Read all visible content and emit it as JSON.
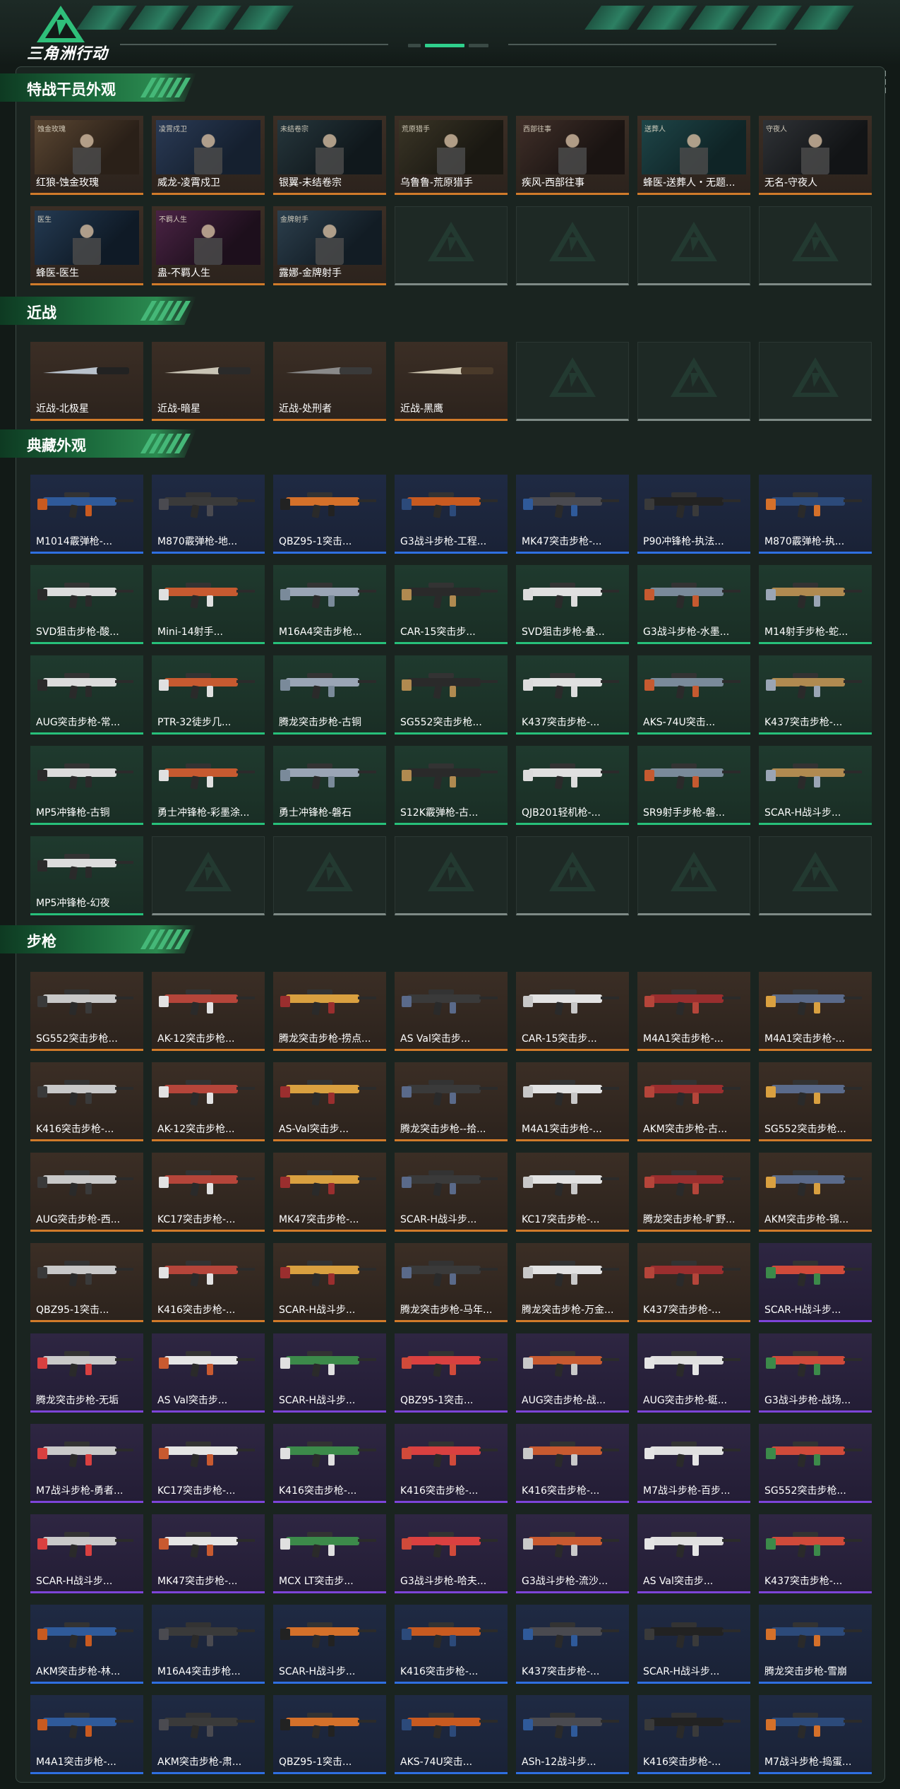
{
  "app": {
    "title": "三角洲行动"
  },
  "colors": {
    "rarity_orange": "#d07a2a",
    "rarity_blue": "#2f6fe0",
    "rarity_green": "#27c07a",
    "rarity_purple": "#7d44d8",
    "accent_green": "#2fd08c"
  },
  "sections": [
    {
      "title": "特战干员外观",
      "items": [
        {
          "name": "红狼-蚀金玫瑰",
          "rarity": "orange",
          "thumb_tag": "蚀金玫瑰"
        },
        {
          "name": "威龙-凌霄戍卫",
          "rarity": "orange",
          "thumb_tag": "凌霄戍卫"
        },
        {
          "name": "银翼-未结卷宗",
          "rarity": "orange",
          "thumb_tag": "未结卷宗"
        },
        {
          "name": "乌鲁鲁-荒原猎手",
          "rarity": "orange",
          "thumb_tag": "荒原猎手"
        },
        {
          "name": "疾风-西部往事",
          "rarity": "orange",
          "thumb_tag": "西部往事"
        },
        {
          "name": "蜂医-送葬人・无题...",
          "rarity": "orange",
          "thumb_tag": "送葬人"
        },
        {
          "name": "无名-守夜人",
          "rarity": "orange",
          "thumb_tag": "守夜人"
        },
        {
          "name": "蜂医-医生",
          "rarity": "orange",
          "thumb_tag": "医生"
        },
        {
          "name": "蛊-不羁人生",
          "rarity": "orange",
          "thumb_tag": "不羁人生"
        },
        {
          "name": "露娜-金牌射手",
          "rarity": "orange",
          "thumb_tag": "金牌射手"
        }
      ],
      "empty_slots": 4
    },
    {
      "title": "近战",
      "items": [
        {
          "name": "近战-北极星",
          "rarity": "orange"
        },
        {
          "name": "近战-暗星",
          "rarity": "orange"
        },
        {
          "name": "近战-处刑者",
          "rarity": "orange"
        },
        {
          "name": "近战-黑鹰",
          "rarity": "orange"
        }
      ],
      "empty_slots": 3
    },
    {
      "title": "典藏外观",
      "items": [
        {
          "name": "M1014霰弹枪-...",
          "rarity": "blue"
        },
        {
          "name": "M870霰弹枪-地...",
          "rarity": "blue"
        },
        {
          "name": "QBZ95-1突击...",
          "rarity": "blue"
        },
        {
          "name": "G3战斗步枪-工程...",
          "rarity": "blue"
        },
        {
          "name": "MK47突击步枪-...",
          "rarity": "blue"
        },
        {
          "name": "P90冲锋枪-执法...",
          "rarity": "blue"
        },
        {
          "name": "M870霰弹枪-执...",
          "rarity": "blue"
        },
        {
          "name": "SVD狙击步枪-酸...",
          "rarity": "green"
        },
        {
          "name": "Mini-14射手...",
          "rarity": "green"
        },
        {
          "name": "M16A4突击步枪...",
          "rarity": "green"
        },
        {
          "name": "CAR-15突击步...",
          "rarity": "green"
        },
        {
          "name": "SVD狙击步枪-叠...",
          "rarity": "green"
        },
        {
          "name": "G3战斗步枪-水墨...",
          "rarity": "green"
        },
        {
          "name": "M14射手步枪-蛇...",
          "rarity": "green"
        },
        {
          "name": "AUG突击步枪-常...",
          "rarity": "green"
        },
        {
          "name": "PTR-32徒步几...",
          "rarity": "green"
        },
        {
          "name": "腾龙突击步枪-古铜",
          "rarity": "green"
        },
        {
          "name": "SG552突击步枪...",
          "rarity": "green"
        },
        {
          "name": "K437突击步枪-...",
          "rarity": "green"
        },
        {
          "name": "AKS-74U突击...",
          "rarity": "green"
        },
        {
          "name": "K437突击步枪-...",
          "rarity": "green"
        },
        {
          "name": "MP5冲锋枪-古铜",
          "rarity": "green"
        },
        {
          "name": "勇士冲锋枪-彩墨涂...",
          "rarity": "green"
        },
        {
          "name": "勇士冲锋枪-磐石",
          "rarity": "green"
        },
        {
          "name": "S12K霰弹枪-古...",
          "rarity": "green"
        },
        {
          "name": "QJB201轻机枪-...",
          "rarity": "green"
        },
        {
          "name": "SR9射手步枪-磐...",
          "rarity": "green"
        },
        {
          "name": "SCAR-H战斗步...",
          "rarity": "green"
        },
        {
          "name": "MP5冲锋枪-幻夜",
          "rarity": "green"
        }
      ],
      "empty_slots": 6
    },
    {
      "title": "步枪",
      "items": [
        {
          "name": "SG552突击步枪...",
          "rarity": "orange"
        },
        {
          "name": "AK-12突击步枪...",
          "rarity": "orange"
        },
        {
          "name": "腾龙突击步枪-捞点...",
          "rarity": "orange"
        },
        {
          "name": "AS Val突击步...",
          "rarity": "orange"
        },
        {
          "name": "CAR-15突击步...",
          "rarity": "orange"
        },
        {
          "name": "M4A1突击步枪-...",
          "rarity": "orange"
        },
        {
          "name": "M4A1突击步枪-...",
          "rarity": "orange"
        },
        {
          "name": "K416突击步枪-...",
          "rarity": "orange"
        },
        {
          "name": "AK-12突击步枪...",
          "rarity": "orange"
        },
        {
          "name": "AS-Val突击步...",
          "rarity": "orange"
        },
        {
          "name": "腾龙突击步枪--拾...",
          "rarity": "orange"
        },
        {
          "name": "M4A1突击步枪-...",
          "rarity": "orange"
        },
        {
          "name": "AKM突击步枪-古...",
          "rarity": "orange"
        },
        {
          "name": "SG552突击步枪...",
          "rarity": "orange"
        },
        {
          "name": "AUG突击步枪-西...",
          "rarity": "orange"
        },
        {
          "name": "KC17突击步枪-...",
          "rarity": "orange"
        },
        {
          "name": "MK47突击步枪-...",
          "rarity": "orange"
        },
        {
          "name": "SCAR-H战斗步...",
          "rarity": "orange"
        },
        {
          "name": "KC17突击步枪-...",
          "rarity": "orange"
        },
        {
          "name": "腾龙突击步枪-旷野...",
          "rarity": "orange"
        },
        {
          "name": "AKM突击步枪-锦...",
          "rarity": "orange"
        },
        {
          "name": "QBZ95-1突击...",
          "rarity": "orange"
        },
        {
          "name": "K416突击步枪-...",
          "rarity": "orange"
        },
        {
          "name": "SCAR-H战斗步...",
          "rarity": "orange"
        },
        {
          "name": "腾龙突击步枪-马年...",
          "rarity": "orange"
        },
        {
          "name": "腾龙突击步枪-万金...",
          "rarity": "orange"
        },
        {
          "name": "K437突击步枪-...",
          "rarity": "orange"
        },
        {
          "name": "SCAR-H战斗步...",
          "rarity": "purple"
        },
        {
          "name": "腾龙突击步枪-无垢",
          "rarity": "purple"
        },
        {
          "name": "AS Val突击步...",
          "rarity": "purple"
        },
        {
          "name": "SCAR-H战斗步...",
          "rarity": "purple"
        },
        {
          "name": "QBZ95-1突击...",
          "rarity": "purple"
        },
        {
          "name": "AUG突击步枪-战...",
          "rarity": "purple"
        },
        {
          "name": "AUG突击步枪-蜓...",
          "rarity": "purple"
        },
        {
          "name": "G3战斗步枪-战场...",
          "rarity": "purple"
        },
        {
          "name": "M7战斗步枪-勇者...",
          "rarity": "purple"
        },
        {
          "name": "KC17突击步枪-...",
          "rarity": "purple"
        },
        {
          "name": "K416突击步枪-...",
          "rarity": "purple"
        },
        {
          "name": "K416突击步枪-...",
          "rarity": "purple"
        },
        {
          "name": "K416突击步枪-...",
          "rarity": "purple"
        },
        {
          "name": "M7战斗步枪-百步...",
          "rarity": "purple"
        },
        {
          "name": "SG552突击步枪...",
          "rarity": "purple"
        },
        {
          "name": "SCAR-H战斗步...",
          "rarity": "purple"
        },
        {
          "name": "MK47突击步枪-...",
          "rarity": "purple"
        },
        {
          "name": "MCX LT突击步...",
          "rarity": "purple"
        },
        {
          "name": "G3战斗步枪-哈夫...",
          "rarity": "purple"
        },
        {
          "name": "G3战斗步枪-流沙...",
          "rarity": "purple"
        },
        {
          "name": "AS Val突击步...",
          "rarity": "purple"
        },
        {
          "name": "K437突击步枪-...",
          "rarity": "purple"
        },
        {
          "name": "AKM突击步枪-林...",
          "rarity": "blue"
        },
        {
          "name": "M16A4突击步枪...",
          "rarity": "blue"
        },
        {
          "name": "SCAR-H战斗步...",
          "rarity": "blue"
        },
        {
          "name": "K416突击步枪-...",
          "rarity": "blue"
        },
        {
          "name": "K437突击步枪-...",
          "rarity": "blue"
        },
        {
          "name": "SCAR-H战斗步...",
          "rarity": "blue"
        },
        {
          "name": "腾龙突击步枪-雪崩",
          "rarity": "blue"
        },
        {
          "name": "M4A1突击步枪-...",
          "rarity": "blue"
        },
        {
          "name": "AKM突击步枪-肃...",
          "rarity": "blue"
        },
        {
          "name": "QBZ95-1突击...",
          "rarity": "blue"
        },
        {
          "name": "AKS-74U突击...",
          "rarity": "blue"
        },
        {
          "name": "ASh-12战斗步...",
          "rarity": "blue"
        },
        {
          "name": "K416突击步枪-...",
          "rarity": "blue"
        },
        {
          "name": "M7战斗步枪-捣蛋...",
          "rarity": "blue"
        }
      ],
      "empty_slots": 0
    }
  ]
}
